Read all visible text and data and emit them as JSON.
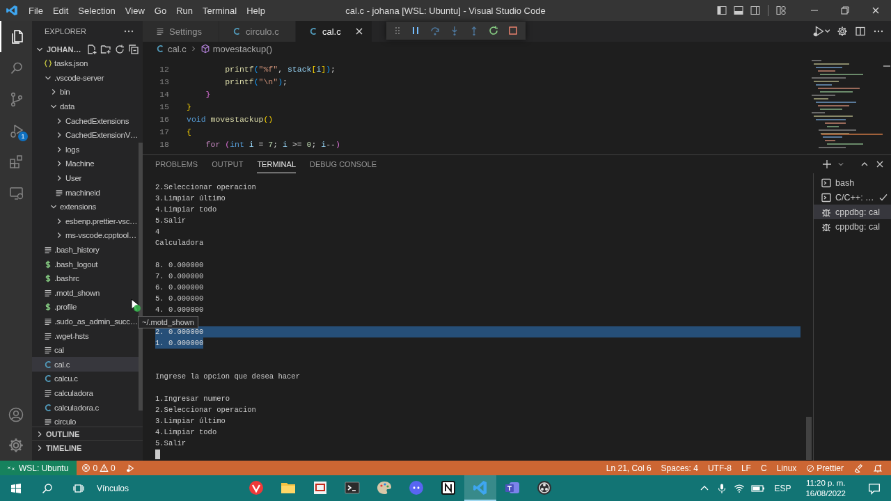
{
  "window": {
    "title": "cal.c - johana [WSL: Ubuntu] - Visual Studio Code"
  },
  "menu": [
    "File",
    "Edit",
    "Selection",
    "View",
    "Go",
    "Run",
    "Terminal",
    "Help"
  ],
  "activity_bar": [
    {
      "kind": "explorer",
      "selected": true
    },
    {
      "kind": "search",
      "selected": false
    },
    {
      "kind": "source-control",
      "selected": false
    },
    {
      "kind": "debug",
      "selected": false,
      "badge": "1"
    },
    {
      "kind": "extensions",
      "selected": false
    },
    {
      "kind": "remote",
      "selected": false
    }
  ],
  "sidebar": {
    "title": "EXPLORER",
    "folder": "JOHAN…",
    "items": [
      {
        "name": "tasks.json",
        "kind": "json",
        "selected": false
      },
      {
        "name": ".vscode-server",
        "kind": "folder",
        "expanded": true,
        "selected": false,
        "children": [
          {
            "name": "bin",
            "kind": "folder",
            "expanded": false,
            "selected": false
          },
          {
            "name": "data",
            "kind": "folder",
            "expanded": true,
            "selected": false,
            "children": [
              {
                "name": "CachedExtensions",
                "kind": "folder",
                "expanded": false,
                "selected": false
              },
              {
                "name": "CachedExtensionV…",
                "kind": "folder",
                "expanded": false,
                "selected": false
              },
              {
                "name": "logs",
                "kind": "folder",
                "expanded": false,
                "selected": false
              },
              {
                "name": "Machine",
                "kind": "folder",
                "expanded": false,
                "selected": false
              },
              {
                "name": "User",
                "kind": "folder",
                "expanded": false,
                "selected": false
              },
              {
                "name": "machineid",
                "kind": "file",
                "selected": false
              }
            ]
          },
          {
            "name": "extensions",
            "kind": "folder",
            "expanded": true,
            "selected": false,
            "children": [
              {
                "name": "esbenp.prettier-vsc…",
                "kind": "folder",
                "expanded": false,
                "selected": false
              },
              {
                "name": "ms-vscode.cpptool…",
                "kind": "folder",
                "expanded": false,
                "selected": false
              }
            ]
          }
        ]
      },
      {
        "name": ".bash_history",
        "kind": "file",
        "selected": false
      },
      {
        "name": ".bash_logout",
        "kind": "shell",
        "selected": false
      },
      {
        "name": ".bashrc",
        "kind": "shell",
        "selected": false
      },
      {
        "name": ".motd_shown",
        "kind": "file",
        "selected": false
      },
      {
        "name": ".profile",
        "kind": "shell",
        "selected": false
      },
      {
        "name": ".sudo_as_admin_succ…",
        "kind": "file",
        "selected": false
      },
      {
        "name": ".wget-hsts",
        "kind": "file",
        "selected": false
      },
      {
        "name": "cal",
        "kind": "file",
        "selected": false
      },
      {
        "name": "cal.c",
        "kind": "c",
        "selected": true
      },
      {
        "name": "calcu.c",
        "kind": "c",
        "selected": false
      },
      {
        "name": "calculadora",
        "kind": "file",
        "selected": false
      },
      {
        "name": "calculadora.c",
        "kind": "c",
        "selected": false
      },
      {
        "name": "circulo",
        "kind": "file",
        "selected": false
      }
    ],
    "sections": [
      {
        "name": "OUTLINE",
        "expanded": false
      },
      {
        "name": "TIMELINE",
        "expanded": false
      }
    ]
  },
  "tabs": [
    {
      "label": "Settings",
      "kind": "settings",
      "selected": false
    },
    {
      "label": "circulo.c",
      "kind": "c",
      "selected": false
    },
    {
      "label": "cal.c",
      "kind": "c",
      "selected": true
    }
  ],
  "breadcrumb": [
    {
      "label": "cal.c",
      "kind": "c"
    },
    {
      "label": "movestackup()",
      "kind": "symbol"
    }
  ],
  "code": [
    {
      "number": "12",
      "tokens": [
        {
          "kind": "fn",
          "text": "        printf"
        },
        {
          "kind": "b3",
          "text": "("
        },
        {
          "kind": "str",
          "text": "\"%f\""
        },
        {
          "kind": "plain",
          "text": ", "
        },
        {
          "kind": "var",
          "text": "stack"
        },
        {
          "kind": "b1",
          "text": "["
        },
        {
          "kind": "var",
          "text": "i"
        },
        {
          "kind": "b1",
          "text": "]"
        },
        {
          "kind": "b3",
          "text": ")"
        },
        {
          "kind": "plain",
          "text": ";"
        }
      ]
    },
    {
      "number": "13",
      "tokens": [
        {
          "kind": "fn",
          "text": "        printf"
        },
        {
          "kind": "b3",
          "text": "("
        },
        {
          "kind": "str",
          "text": "\"\\n\""
        },
        {
          "kind": "b3",
          "text": ")"
        },
        {
          "kind": "plain",
          "text": ";"
        }
      ]
    },
    {
      "number": "14",
      "tokens": [
        {
          "kind": "b2",
          "text": "    }"
        }
      ]
    },
    {
      "number": "15",
      "tokens": [
        {
          "kind": "b1",
          "text": "}"
        }
      ]
    },
    {
      "number": "16",
      "tokens": [
        {
          "kind": "type",
          "text": "void "
        },
        {
          "kind": "fn",
          "text": "movestackup"
        },
        {
          "kind": "b1",
          "text": "()"
        }
      ]
    },
    {
      "number": "17",
      "tokens": [
        {
          "kind": "b1",
          "text": "{"
        }
      ]
    },
    {
      "number": "18",
      "tokens": [
        {
          "kind": "kw",
          "text": "    for "
        },
        {
          "kind": "b2",
          "text": "("
        },
        {
          "kind": "type",
          "text": "int "
        },
        {
          "kind": "var",
          "text": "i"
        },
        {
          "kind": "plain",
          "text": " = "
        },
        {
          "kind": "num",
          "text": "7"
        },
        {
          "kind": "plain",
          "text": "; "
        },
        {
          "kind": "var",
          "text": "i"
        },
        {
          "kind": "plain",
          "text": " >= "
        },
        {
          "kind": "num",
          "text": "0"
        },
        {
          "kind": "plain",
          "text": "; "
        },
        {
          "kind": "var",
          "text": "i"
        },
        {
          "kind": "plain",
          "text": "--"
        },
        {
          "kind": "b2",
          "text": ")"
        }
      ]
    }
  ],
  "panel": {
    "tabs": [
      {
        "label": "PROBLEMS",
        "selected": false
      },
      {
        "label": "OUTPUT",
        "selected": false
      },
      {
        "label": "TERMINAL",
        "selected": true
      },
      {
        "label": "DEBUG CONSOLE",
        "selected": false
      }
    ],
    "lines": [
      {
        "kind": "text",
        "text": "2.Seleccionar operacion",
        "selected": false
      },
      {
        "kind": "text",
        "text": "3.Limpiar último",
        "selected": false
      },
      {
        "kind": "text",
        "text": "4.Limpiar todo",
        "selected": false
      },
      {
        "kind": "text",
        "text": "5.Salir",
        "selected": false
      },
      {
        "kind": "text",
        "text": "4",
        "selected": false
      },
      {
        "kind": "text",
        "text": "Calculadora",
        "selected": false
      },
      {
        "kind": "blank"
      },
      {
        "kind": "text",
        "text": "8. 0.000000",
        "selected": false
      },
      {
        "kind": "text",
        "text": "7. 0.000000",
        "selected": false
      },
      {
        "kind": "text",
        "text": "6. 0.000000",
        "selected": false
      },
      {
        "kind": "text",
        "text": "5. 0.000000",
        "selected": false
      },
      {
        "kind": "text",
        "text": "4. 0.000000",
        "selected": false
      },
      {
        "kind": "blank"
      },
      {
        "kind": "text",
        "text": "2. 0.000000",
        "selected": true
      },
      {
        "kind": "text",
        "text": "1. 0.000000",
        "selected": true
      },
      {
        "kind": "blank"
      },
      {
        "kind": "blank"
      },
      {
        "kind": "text",
        "text": "Ingrese la opcion que desea hacer",
        "selected": false
      },
      {
        "kind": "blank"
      },
      {
        "kind": "text",
        "text": "1.Ingresar numero",
        "selected": false
      },
      {
        "kind": "text",
        "text": "2.Seleccionar operacion",
        "selected": false
      },
      {
        "kind": "text",
        "text": "3.Limpiar último",
        "selected": false
      },
      {
        "kind": "text",
        "text": "4.Limpiar todo",
        "selected": false
      },
      {
        "kind": "text",
        "text": "5.Salir",
        "selected": false
      },
      {
        "kind": "cursor"
      }
    ],
    "terminals": [
      {
        "label": "bash",
        "kind": "shell",
        "selected": false,
        "done": false
      },
      {
        "label": "C/C++: …",
        "kind": "task",
        "selected": false,
        "done": true
      },
      {
        "label": "cppdbg: cal",
        "kind": "debug",
        "selected": true,
        "done": false
      },
      {
        "label": "cppdbg: cal",
        "kind": "debug",
        "selected": false,
        "done": false
      }
    ]
  },
  "tooltip": "~/.motd_shown",
  "status_bar": {
    "remote": "WSL: Ubuntu",
    "errors": "0",
    "warnings": "0",
    "items": [
      {
        "kind": "text",
        "label": "Ln 21, Col 6"
      },
      {
        "kind": "text",
        "label": "Spaces: 4"
      },
      {
        "kind": "text",
        "label": "UTF-8"
      },
      {
        "kind": "text",
        "label": "LF"
      },
      {
        "kind": "text",
        "label": "C"
      },
      {
        "kind": "text",
        "label": "Linux"
      },
      {
        "kind": "prettier",
        "label": "Prettier"
      }
    ]
  },
  "taskbar": {
    "links": "Vínculos",
    "apps": [
      {
        "kind": "browser",
        "selected": false
      },
      {
        "kind": "files",
        "selected": false
      },
      {
        "kind": "viewer",
        "selected": false
      },
      {
        "kind": "terminal",
        "selected": false
      },
      {
        "kind": "paint",
        "selected": false
      },
      {
        "kind": "chat",
        "selected": false
      },
      {
        "kind": "notes",
        "selected": false
      },
      {
        "kind": "code",
        "selected": true
      },
      {
        "kind": "teams",
        "selected": false
      },
      {
        "kind": "recorder",
        "selected": false
      }
    ],
    "language": "ESP",
    "time": "11:20 p. m.",
    "date": "16/08/2022"
  }
}
